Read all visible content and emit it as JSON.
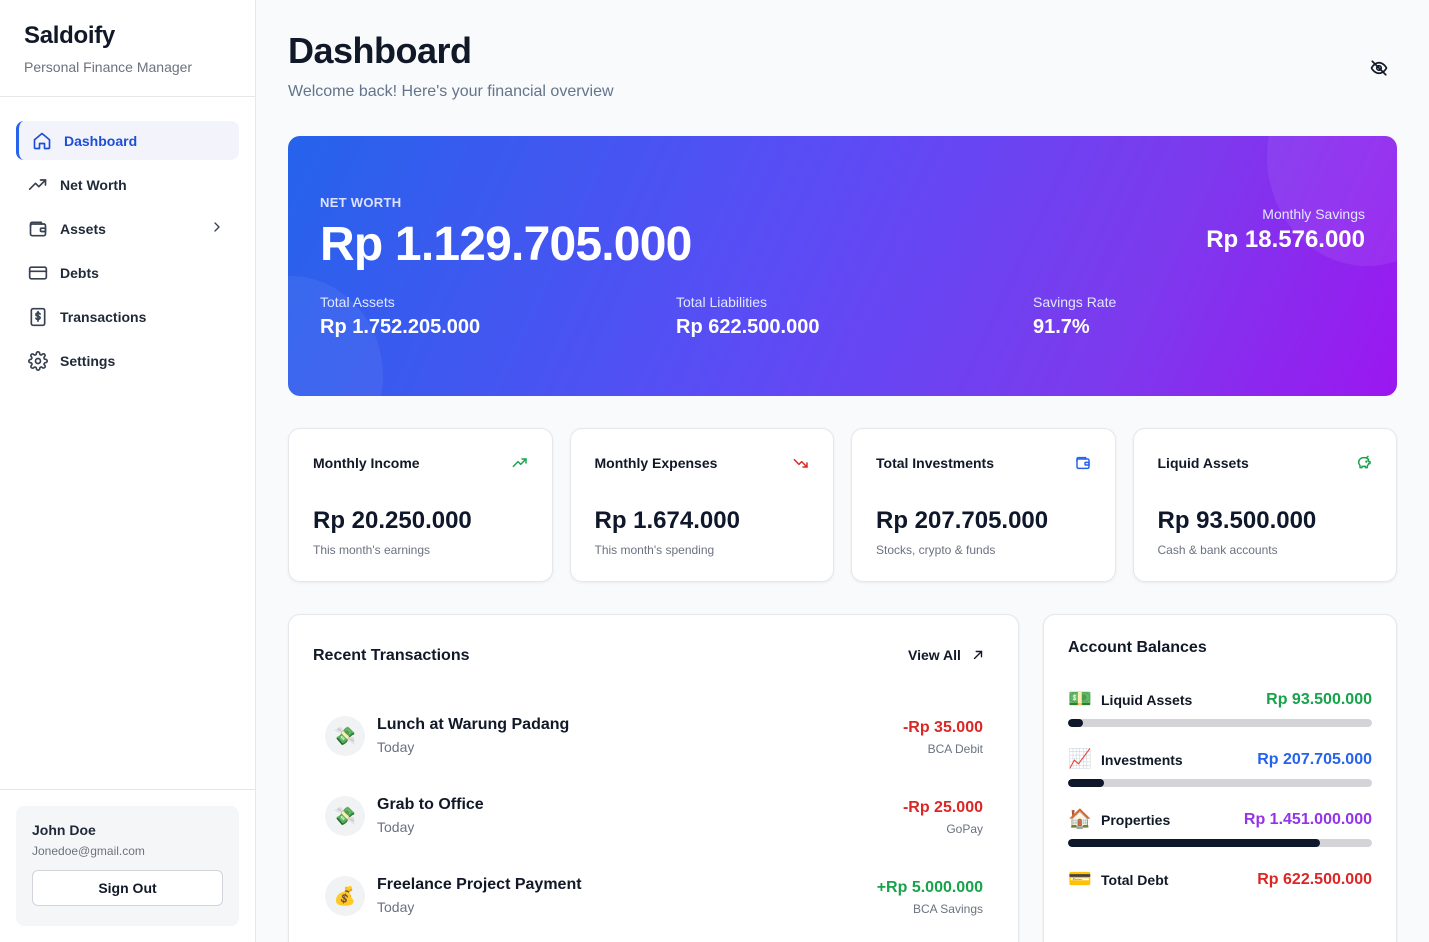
{
  "app": {
    "name": "Saldoify",
    "subtitle": "Personal Finance Manager"
  },
  "nav": [
    {
      "label": "Dashboard",
      "icon": "home-icon",
      "active": true
    },
    {
      "label": "Net Worth",
      "icon": "trending-up-icon"
    },
    {
      "label": "Assets",
      "icon": "wallet-icon",
      "expandable": true
    },
    {
      "label": "Debts",
      "icon": "credit-card-icon"
    },
    {
      "label": "Transactions",
      "icon": "receipt-icon"
    },
    {
      "label": "Settings",
      "icon": "gear-icon"
    }
  ],
  "user": {
    "name": "John Doe",
    "email": "Jonedoe@gmail.com",
    "signout_label": "Sign Out"
  },
  "header": {
    "title": "Dashboard",
    "subtitle": "Welcome back! Here's your financial overview",
    "toggle_icon": "eye-off-icon"
  },
  "hero": {
    "net_worth_label": "NET WORTH",
    "net_worth_value": "Rp 1.129.705.000",
    "monthly_savings_label": "Monthly Savings",
    "monthly_savings_value": "Rp 18.576.000",
    "stats": [
      {
        "label": "Total Assets",
        "value": "Rp 1.752.205.000"
      },
      {
        "label": "Total Liabilities",
        "value": "Rp 622.500.000"
      },
      {
        "label": "Savings Rate",
        "value": "91.7%"
      }
    ],
    "gradient": [
      "#2563eb",
      "#9b17f0"
    ]
  },
  "cards": [
    {
      "title": "Monthly Income",
      "value": "Rp 20.250.000",
      "sub": "This month's earnings",
      "icon": "trending-up-icon",
      "color": "#16a34a"
    },
    {
      "title": "Monthly Expenses",
      "value": "Rp 1.674.000",
      "sub": "This month's spending",
      "icon": "trending-down-icon",
      "color": "#dc2626"
    },
    {
      "title": "Total Investments",
      "value": "Rp 207.705.000",
      "sub": "Stocks, crypto & funds",
      "icon": "wallet-icon",
      "color": "#2563eb"
    },
    {
      "title": "Liquid Assets",
      "value": "Rp 93.500.000",
      "sub": "Cash & bank accounts",
      "icon": "piggy-bank-icon",
      "color": "#16a34a"
    }
  ],
  "transactions": {
    "title": "Recent Transactions",
    "view_all_label": "View All",
    "items": [
      {
        "icon": "💸",
        "name": "Lunch at Warung Padang",
        "date": "Today",
        "amount": "-Rp 35.000",
        "account": "BCA Debit",
        "type": "neg"
      },
      {
        "icon": "💸",
        "name": "Grab to Office",
        "date": "Today",
        "amount": "-Rp 25.000",
        "account": "GoPay",
        "type": "neg"
      },
      {
        "icon": "💰",
        "name": "Freelance Project Payment",
        "date": "Today",
        "amount": "+Rp 5.000.000",
        "account": "BCA Savings",
        "type": "pos"
      }
    ]
  },
  "balances": {
    "title": "Account Balances",
    "items": [
      {
        "icon": "💵",
        "label": "Liquid Assets",
        "value": "Rp 93.500.000",
        "color": "#16a34a",
        "progress": 0.05,
        "bar": true
      },
      {
        "icon": "📈",
        "label": "Investments",
        "value": "Rp 207.705.000",
        "color": "#2563eb",
        "progress": 0.12,
        "bar": true
      },
      {
        "icon": "🏠",
        "label": "Properties",
        "value": "Rp 1.451.000.000",
        "color": "#9333ea",
        "progress": 0.83,
        "bar": true
      },
      {
        "icon": "💳",
        "label": "Total Debt",
        "value": "Rp 622.500.000",
        "color": "#dc2626",
        "bar": false
      }
    ]
  }
}
